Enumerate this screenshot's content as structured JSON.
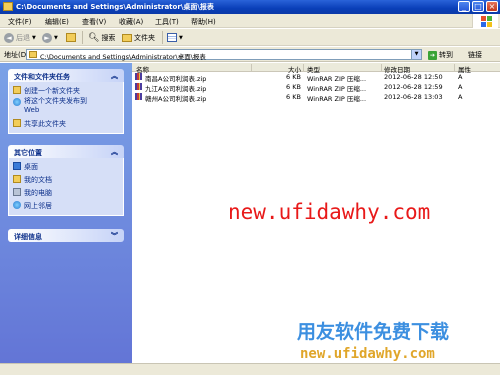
{
  "window": {
    "title": "C:\\Documents and Settings\\Administrator\\桌面\\报表",
    "minimize": "_",
    "maximize": "□",
    "close": "×"
  },
  "menu": [
    "文件(F)",
    "编辑(E)",
    "查看(V)",
    "收藏(A)",
    "工具(T)",
    "帮助(H)"
  ],
  "toolbar": {
    "back": "后退",
    "search": "搜索",
    "folders": "文件夹"
  },
  "address": {
    "label": "地址(D)",
    "value": "C:\\Documents and Settings\\Administrator\\桌面\\报表",
    "go": "转到",
    "links": "链接"
  },
  "sidebar": {
    "tasks_title": "文件和文件夹任务",
    "tasks": [
      "创建一个新文件夹",
      "将这个文件夹发布到\nWeb",
      "共享此文件夹"
    ],
    "places_title": "其它位置",
    "places": [
      "桌面",
      "我的文档",
      "我的电脑",
      "网上邻居"
    ],
    "details_title": "详细信息"
  },
  "columns": {
    "name": "名称",
    "size": "大小",
    "type": "类型",
    "modified": "修改日期",
    "attr": "属性"
  },
  "files": [
    {
      "name": "南昌A公司利润表.zip",
      "size": "6 KB",
      "type": "WinRAR ZIP 压缩...",
      "modified": "2012-06-28 12:50",
      "attr": "A"
    },
    {
      "name": "九江A公司利润表.zip",
      "size": "6 KB",
      "type": "WinRAR ZIP 压缩...",
      "modified": "2012-06-28 12:59",
      "attr": "A"
    },
    {
      "name": "赣州A公司利润表.zip",
      "size": "6 KB",
      "type": "WinRAR ZIP 压缩...",
      "modified": "2012-06-28 13:03",
      "attr": "A"
    }
  ],
  "watermark": {
    "url_red": "new.ufidawhy.com",
    "cn_blue": "用友软件免费下载",
    "url_orange": "new.ufidawhy.com"
  }
}
